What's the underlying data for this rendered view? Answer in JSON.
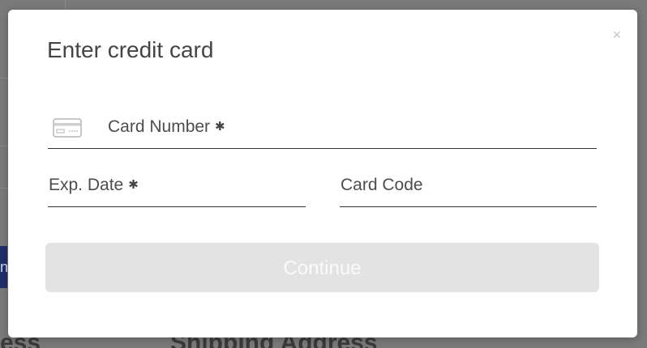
{
  "background": {
    "button_fragment": "n",
    "heading_left": "ess",
    "heading_right": "Shipping Address"
  },
  "modal": {
    "title": "Enter credit card",
    "close_glyph": "×",
    "required_glyph": "✱",
    "fields": {
      "card_number": {
        "label": "Card Number",
        "required": true,
        "icon": "credit-card-icon"
      },
      "exp_date": {
        "label": "Exp. Date",
        "required": true
      },
      "card_code": {
        "label": "Card Code",
        "required": false
      }
    },
    "continue_label": "Continue",
    "continue_enabled": false
  },
  "colors": {
    "overlay": "#7a7a7a",
    "modal_bg": "#ffffff",
    "button_disabled_bg": "#e3e3e3",
    "background_button": "#1f2f6b"
  }
}
